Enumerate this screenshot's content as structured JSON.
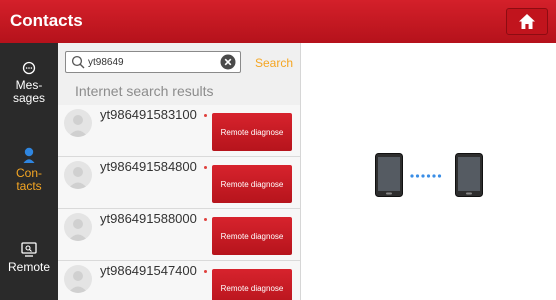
{
  "header": {
    "title": "Contacts",
    "home_icon": "home-icon"
  },
  "sidebar": {
    "items": [
      {
        "label": "Mes-\nsages",
        "line1": "Mes-",
        "line2": "sages",
        "icon": "chat-bubble-icon",
        "active": false
      },
      {
        "label": "Con-\ntacts",
        "line1": "Con-",
        "line2": "tacts",
        "icon": "person-icon",
        "active": true
      },
      {
        "label": "Remote",
        "line1": "Remote",
        "icon": "remote-screen-icon",
        "active": false
      }
    ],
    "active_color": "#f5a623"
  },
  "search": {
    "value": "yt98649",
    "placeholder": "",
    "search_label": "Search"
  },
  "results": {
    "section_title": "Internet search results",
    "button_label": "Remote diagnose",
    "rows": [
      {
        "name": "yt986491583100"
      },
      {
        "name": "yt986491584800"
      },
      {
        "name": "yt986491588000"
      },
      {
        "name": "yt986491547400"
      }
    ]
  },
  "colors": {
    "brand_red": "#c8141e",
    "sidebar_bg": "#2a2a2a",
    "link_dot": "#3a8ee6"
  }
}
